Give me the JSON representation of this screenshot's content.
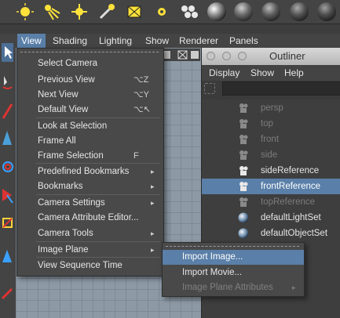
{
  "panel_menu": {
    "items": [
      "View",
      "Shading",
      "Lighting",
      "Show",
      "Renderer",
      "Panels"
    ],
    "active": "View"
  },
  "view_menu": {
    "items": [
      {
        "label": "Select Camera",
        "shortcut": "",
        "submenu": false
      },
      {
        "label": "Previous View",
        "shortcut": "⌥Z",
        "submenu": false
      },
      {
        "label": "Next View",
        "shortcut": "⌥Y",
        "submenu": false
      },
      {
        "label": "Default View",
        "shortcut": "⌥↖",
        "submenu": false
      },
      {
        "label": "Look at Selection",
        "shortcut": "",
        "submenu": false
      },
      {
        "label": "Frame All",
        "shortcut": "",
        "submenu": false
      },
      {
        "label": "Frame Selection",
        "shortcut": "F",
        "submenu": false
      },
      {
        "label": "Predefined Bookmarks",
        "shortcut": "",
        "submenu": true
      },
      {
        "label": "Bookmarks",
        "shortcut": "",
        "submenu": true
      },
      {
        "label": "Camera Settings",
        "shortcut": "",
        "submenu": true
      },
      {
        "label": "Camera Attribute Editor...",
        "shortcut": "",
        "submenu": false
      },
      {
        "label": "Camera Tools",
        "shortcut": "",
        "submenu": true
      },
      {
        "label": "Image Plane",
        "shortcut": "",
        "submenu": true
      },
      {
        "label": "View Sequence Time",
        "shortcut": "",
        "submenu": false
      }
    ]
  },
  "image_plane_menu": {
    "items": [
      {
        "label": "Import Image...",
        "state": "highlighted"
      },
      {
        "label": "Import Movie...",
        "state": "normal"
      },
      {
        "label": "Image Plane Attributes",
        "state": "disabled",
        "submenu": true
      }
    ]
  },
  "outliner": {
    "title": "Outliner",
    "menus": [
      "Display",
      "Show",
      "Help"
    ],
    "items": [
      {
        "name": "persp",
        "type": "camera",
        "dimmed": true,
        "selected": false
      },
      {
        "name": "top",
        "type": "camera",
        "dimmed": true,
        "selected": false
      },
      {
        "name": "front",
        "type": "camera",
        "dimmed": true,
        "selected": false
      },
      {
        "name": "side",
        "type": "camera",
        "dimmed": true,
        "selected": false
      },
      {
        "name": "sideReference",
        "type": "camera",
        "dimmed": false,
        "selected": false
      },
      {
        "name": "frontReference",
        "type": "camera",
        "dimmed": false,
        "selected": true
      },
      {
        "name": "topReference",
        "type": "camera",
        "dimmed": true,
        "selected": false
      },
      {
        "name": "defaultLightSet",
        "type": "set",
        "dimmed": false,
        "selected": false
      },
      {
        "name": "defaultObjectSet",
        "type": "set",
        "dimmed": false,
        "selected": false
      }
    ]
  },
  "shelf": {
    "icons": [
      "directional-light-icon",
      "spot-light-icon",
      "point-light-icon",
      "area-light-icon",
      "volume-light-icon",
      "ambient-light-icon",
      "lights-group-icon",
      "material-sphere-icon",
      "material-sphere-icon",
      "material-sphere-icon",
      "material-sphere-icon",
      "material-sphere-icon"
    ]
  },
  "colors": {
    "highlight": "#5a7fa8",
    "menu_bg": "#494949",
    "viewport": "#8d9aa6",
    "dim_text": "#7c7c7c"
  }
}
